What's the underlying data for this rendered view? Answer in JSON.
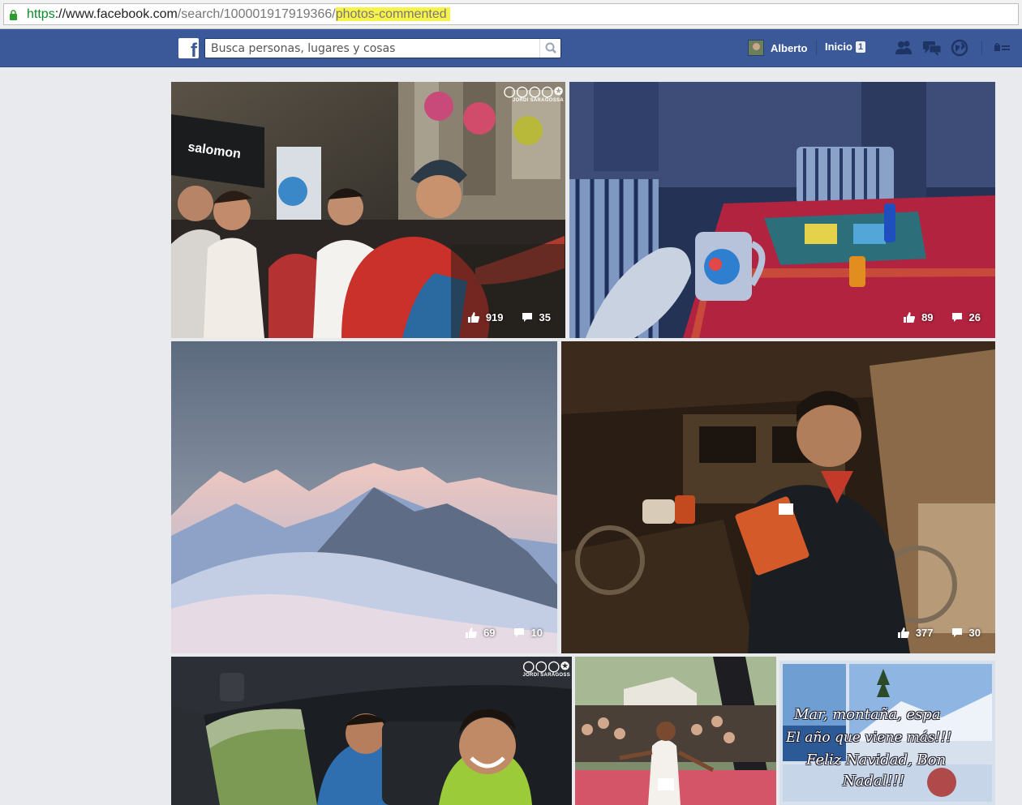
{
  "browser": {
    "url_protocol": "https",
    "url_host": "://www.facebook.com",
    "url_path": "/search/100001917919366/",
    "url_highlight": "photos-commented"
  },
  "fb": {
    "search_placeholder": "Busca personas, lugares y cosas",
    "user_name": "Alberto",
    "home_label": "Inicio",
    "home_count": "1"
  },
  "photos": [
    {
      "likes": "919",
      "comments": "35",
      "watermark": "JORDI SARAGOSSA"
    },
    {
      "likes": "89",
      "comments": "26"
    },
    {
      "likes": "69",
      "comments": "10"
    },
    {
      "likes": "377",
      "comments": "30"
    },
    {
      "watermark": "JORDI SARAGOSS"
    },
    {},
    {
      "text_lines": [
        "Mar, montaña, espa",
        "El año que viene más!!!",
        "Feliz Navidad, Bon",
        "Nadal!!!"
      ]
    }
  ]
}
